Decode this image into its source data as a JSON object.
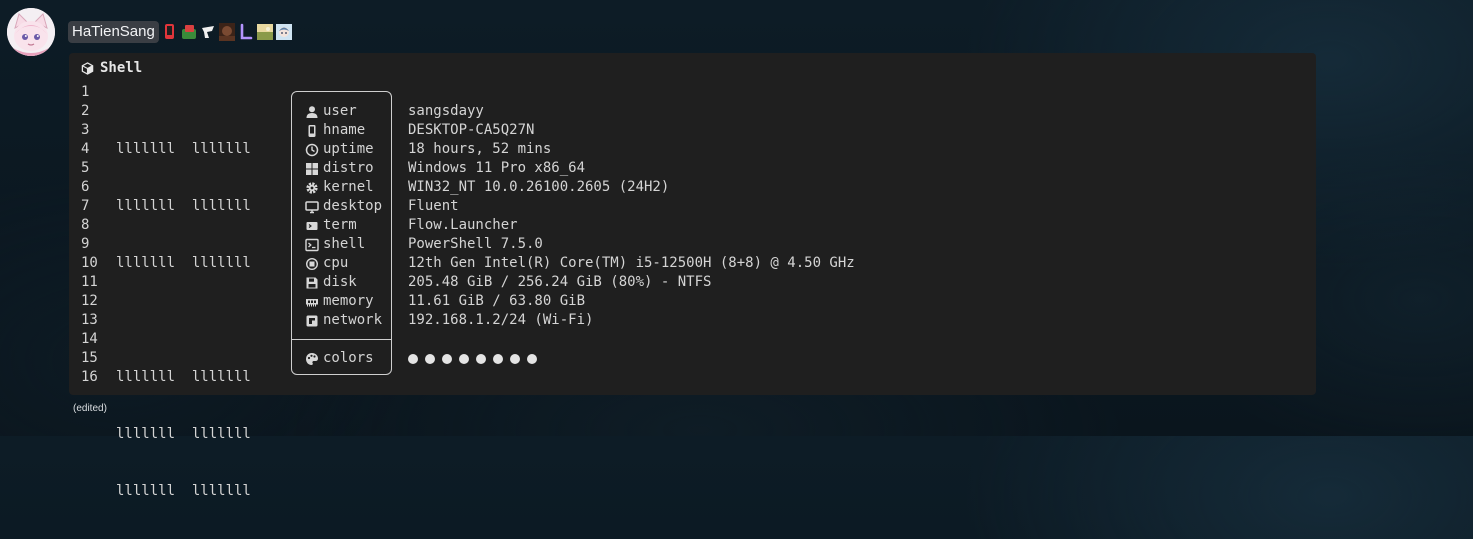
{
  "message": {
    "author": "HaTienSang",
    "edited_label": "(edited)"
  },
  "codeblock": {
    "language": "Shell",
    "line_numbers": [
      "1",
      "2",
      "3",
      "4",
      "5",
      "6",
      "7",
      "8",
      "9",
      "10",
      "11",
      "12",
      "13",
      "14",
      "15",
      "16"
    ],
    "logo_lines": [
      "lllllll  lllllll",
      "lllllll  lllllll",
      "lllllll  lllllll",
      "",
      "lllllll  lllllll",
      "lllllll  lllllll",
      "lllllll  lllllll"
    ],
    "info": [
      {
        "key": "user",
        "value": "sangsdayy",
        "icon": "user-icon"
      },
      {
        "key": "hname",
        "value": "DESKTOP-CA5Q27N",
        "icon": "phone-icon"
      },
      {
        "key": "uptime",
        "value": "18 hours, 52 mins",
        "icon": "clock-icon"
      },
      {
        "key": "distro",
        "value": "Windows 11 Pro x86_64",
        "icon": "windows-icon"
      },
      {
        "key": "kernel",
        "value": "WIN32_NT 10.0.26100.2605 (24H2)",
        "icon": "gear-icon"
      },
      {
        "key": "desktop",
        "value": "Fluent",
        "icon": "monitor-icon"
      },
      {
        "key": "term",
        "value": "Flow.Launcher",
        "icon": "terminal-icon"
      },
      {
        "key": "shell",
        "value": "PowerShell 7.5.0",
        "icon": "shell-prompt-icon"
      },
      {
        "key": "cpu",
        "value": "12th Gen Intel(R) Core(TM) i5-12500H (8+8) @ 4.50 GHz",
        "icon": "cpu-icon"
      },
      {
        "key": "disk",
        "value": "205.48 GiB / 256.24 GiB (80%) - NTFS",
        "icon": "floppy-disk-icon"
      },
      {
        "key": "memory",
        "value": "11.61 GiB / 63.80 GiB",
        "icon": "memory-chip-icon"
      },
      {
        "key": "network",
        "value": "192.168.1.2/24 (Wi-Fi)",
        "icon": "network-icon"
      }
    ],
    "colors_label": "colors",
    "colors_icon": "palette-icon",
    "color_dot_count": 8
  },
  "badges": [
    {
      "icon": "red-phone-badge",
      "color": "#e0353b"
    },
    {
      "icon": "green-red-badge",
      "color": "#3a8a3a"
    },
    {
      "icon": "black-white-badge",
      "color": "#f0f0f0"
    },
    {
      "icon": "portrait-badge",
      "color": "#7a4a32"
    },
    {
      "icon": "purple-l-badge",
      "color": "#b494ff"
    },
    {
      "icon": "landscape-badge",
      "color": "#a8b05a"
    },
    {
      "icon": "anime-face-badge",
      "color": "#9fc6e6"
    }
  ]
}
